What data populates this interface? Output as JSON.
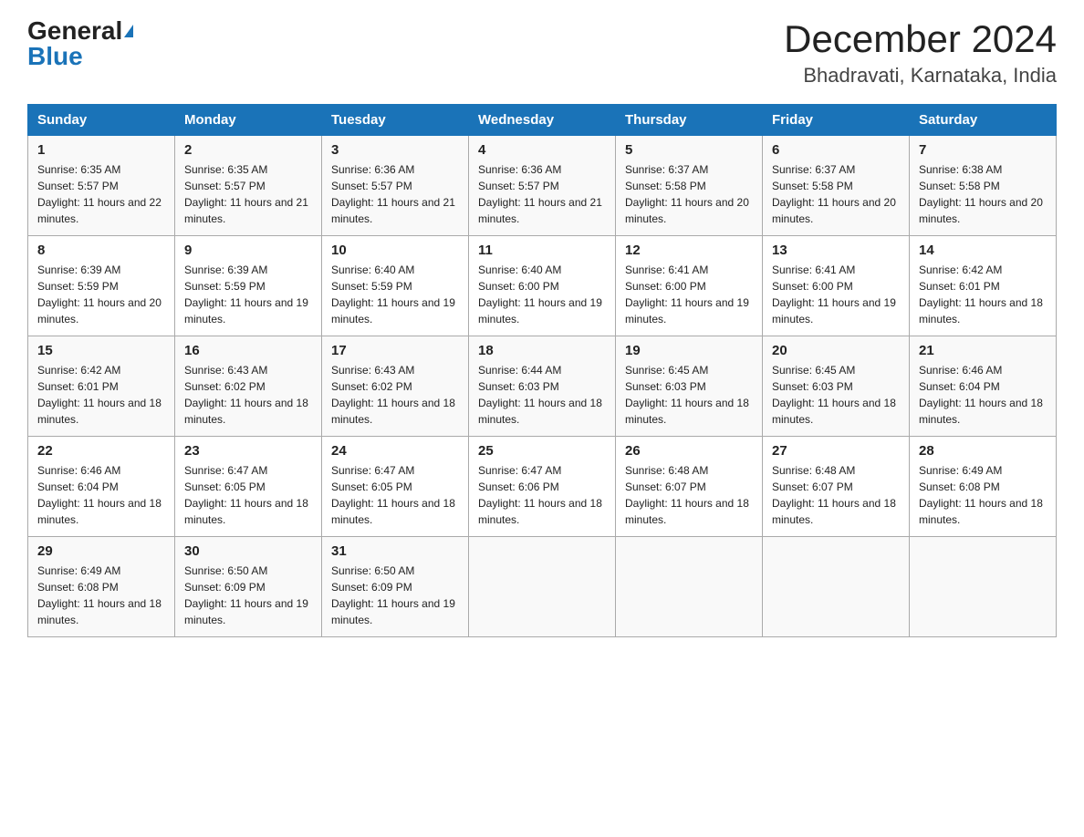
{
  "header": {
    "logo_general": "General",
    "logo_blue": "Blue",
    "month_title": "December 2024",
    "location": "Bhadravati, Karnataka, India"
  },
  "weekdays": [
    "Sunday",
    "Monday",
    "Tuesday",
    "Wednesday",
    "Thursday",
    "Friday",
    "Saturday"
  ],
  "weeks": [
    [
      {
        "day": "1",
        "sunrise": "6:35 AM",
        "sunset": "5:57 PM",
        "daylight": "11 hours and 22 minutes."
      },
      {
        "day": "2",
        "sunrise": "6:35 AM",
        "sunset": "5:57 PM",
        "daylight": "11 hours and 21 minutes."
      },
      {
        "day": "3",
        "sunrise": "6:36 AM",
        "sunset": "5:57 PM",
        "daylight": "11 hours and 21 minutes."
      },
      {
        "day": "4",
        "sunrise": "6:36 AM",
        "sunset": "5:57 PM",
        "daylight": "11 hours and 21 minutes."
      },
      {
        "day": "5",
        "sunrise": "6:37 AM",
        "sunset": "5:58 PM",
        "daylight": "11 hours and 20 minutes."
      },
      {
        "day": "6",
        "sunrise": "6:37 AM",
        "sunset": "5:58 PM",
        "daylight": "11 hours and 20 minutes."
      },
      {
        "day": "7",
        "sunrise": "6:38 AM",
        "sunset": "5:58 PM",
        "daylight": "11 hours and 20 minutes."
      }
    ],
    [
      {
        "day": "8",
        "sunrise": "6:39 AM",
        "sunset": "5:59 PM",
        "daylight": "11 hours and 20 minutes."
      },
      {
        "day": "9",
        "sunrise": "6:39 AM",
        "sunset": "5:59 PM",
        "daylight": "11 hours and 19 minutes."
      },
      {
        "day": "10",
        "sunrise": "6:40 AM",
        "sunset": "5:59 PM",
        "daylight": "11 hours and 19 minutes."
      },
      {
        "day": "11",
        "sunrise": "6:40 AM",
        "sunset": "6:00 PM",
        "daylight": "11 hours and 19 minutes."
      },
      {
        "day": "12",
        "sunrise": "6:41 AM",
        "sunset": "6:00 PM",
        "daylight": "11 hours and 19 minutes."
      },
      {
        "day": "13",
        "sunrise": "6:41 AM",
        "sunset": "6:00 PM",
        "daylight": "11 hours and 19 minutes."
      },
      {
        "day": "14",
        "sunrise": "6:42 AM",
        "sunset": "6:01 PM",
        "daylight": "11 hours and 18 minutes."
      }
    ],
    [
      {
        "day": "15",
        "sunrise": "6:42 AM",
        "sunset": "6:01 PM",
        "daylight": "11 hours and 18 minutes."
      },
      {
        "day": "16",
        "sunrise": "6:43 AM",
        "sunset": "6:02 PM",
        "daylight": "11 hours and 18 minutes."
      },
      {
        "day": "17",
        "sunrise": "6:43 AM",
        "sunset": "6:02 PM",
        "daylight": "11 hours and 18 minutes."
      },
      {
        "day": "18",
        "sunrise": "6:44 AM",
        "sunset": "6:03 PM",
        "daylight": "11 hours and 18 minutes."
      },
      {
        "day": "19",
        "sunrise": "6:45 AM",
        "sunset": "6:03 PM",
        "daylight": "11 hours and 18 minutes."
      },
      {
        "day": "20",
        "sunrise": "6:45 AM",
        "sunset": "6:03 PM",
        "daylight": "11 hours and 18 minutes."
      },
      {
        "day": "21",
        "sunrise": "6:46 AM",
        "sunset": "6:04 PM",
        "daylight": "11 hours and 18 minutes."
      }
    ],
    [
      {
        "day": "22",
        "sunrise": "6:46 AM",
        "sunset": "6:04 PM",
        "daylight": "11 hours and 18 minutes."
      },
      {
        "day": "23",
        "sunrise": "6:47 AM",
        "sunset": "6:05 PM",
        "daylight": "11 hours and 18 minutes."
      },
      {
        "day": "24",
        "sunrise": "6:47 AM",
        "sunset": "6:05 PM",
        "daylight": "11 hours and 18 minutes."
      },
      {
        "day": "25",
        "sunrise": "6:47 AM",
        "sunset": "6:06 PM",
        "daylight": "11 hours and 18 minutes."
      },
      {
        "day": "26",
        "sunrise": "6:48 AM",
        "sunset": "6:07 PM",
        "daylight": "11 hours and 18 minutes."
      },
      {
        "day": "27",
        "sunrise": "6:48 AM",
        "sunset": "6:07 PM",
        "daylight": "11 hours and 18 minutes."
      },
      {
        "day": "28",
        "sunrise": "6:49 AM",
        "sunset": "6:08 PM",
        "daylight": "11 hours and 18 minutes."
      }
    ],
    [
      {
        "day": "29",
        "sunrise": "6:49 AM",
        "sunset": "6:08 PM",
        "daylight": "11 hours and 18 minutes."
      },
      {
        "day": "30",
        "sunrise": "6:50 AM",
        "sunset": "6:09 PM",
        "daylight": "11 hours and 19 minutes."
      },
      {
        "day": "31",
        "sunrise": "6:50 AM",
        "sunset": "6:09 PM",
        "daylight": "11 hours and 19 minutes."
      },
      null,
      null,
      null,
      null
    ]
  ]
}
